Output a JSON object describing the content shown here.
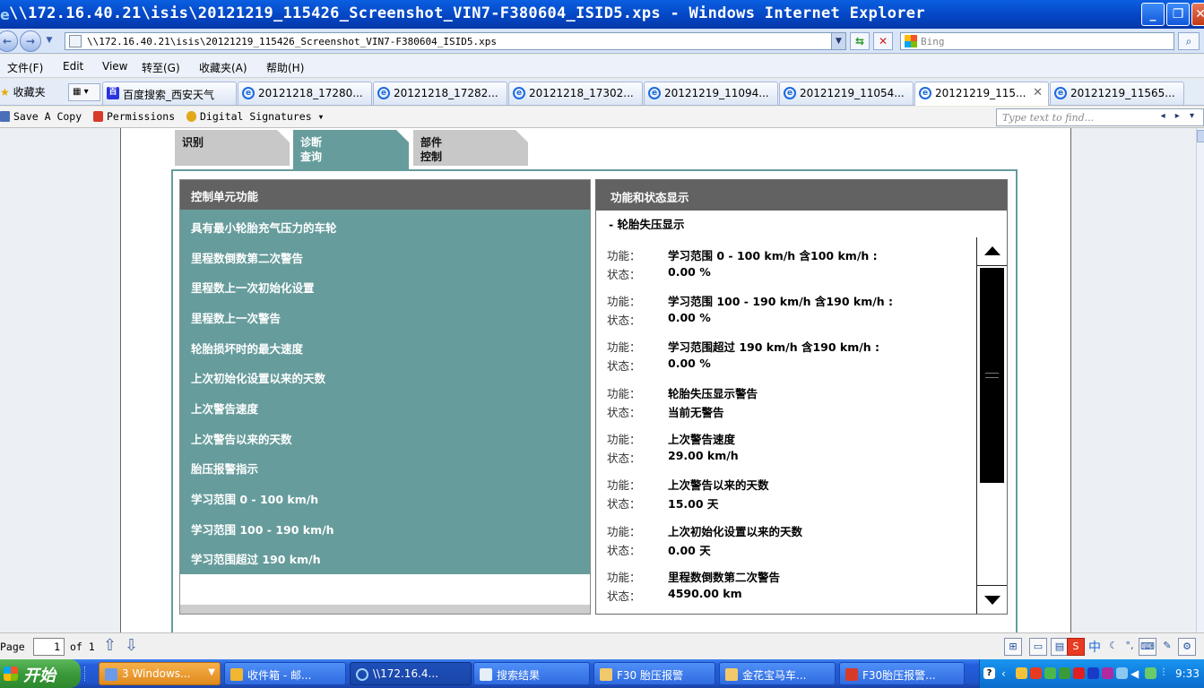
{
  "window": {
    "title": "\\\\172.16.40.21\\isis\\20121219_115426_Screenshot_VIN7-F380604_ISID5.xps - Windows Internet Explorer",
    "url": "\\\\172.16.40.21\\isis\\20121219_115426_Screenshot_VIN7-F380604_ISID5.xps",
    "search_placeholder": "Bing"
  },
  "menu": [
    "文件(F)",
    "Edit",
    "View",
    "转至(G)",
    "收藏夹(A)",
    "帮助(H)"
  ],
  "favorites_label": "收藏夹",
  "tabs": [
    {
      "label": "百度搜索_西安天气",
      "icon": "baidu-icon"
    },
    {
      "label": "20121218_17280...",
      "icon": "ie-icon"
    },
    {
      "label": "20121218_17282...",
      "icon": "ie-icon"
    },
    {
      "label": "20121218_17302...",
      "icon": "ie-icon"
    },
    {
      "label": "20121219_11094...",
      "icon": "ie-icon"
    },
    {
      "label": "20121219_11054...",
      "icon": "ie-icon"
    },
    {
      "label": "20121219_115...",
      "icon": "ie-icon",
      "active": true
    },
    {
      "label": "20121219_11565...",
      "icon": "ie-icon"
    }
  ],
  "xps_toolbar": {
    "save": "Save A Copy",
    "permissions": "Permissions",
    "signatures": "Digital Signatures",
    "find_placeholder": "Type text to find..."
  },
  "diag_tabs": [
    {
      "line1": "识别",
      "line2": ""
    },
    {
      "line1": "诊断",
      "line2": "查询"
    },
    {
      "line1": "部件",
      "line2": "控制"
    }
  ],
  "left_panel": {
    "header": "控制单元功能",
    "items": [
      "具有最小轮胎充气压力的车轮",
      "里程数倒数第二次警告",
      "里程数上一次初始化设置",
      "里程数上一次警告",
      "轮胎损坏时的最大速度",
      "上次初始化设置以来的天数",
      "上次警告速度",
      "上次警告以来的天数",
      "胎压报警指示",
      "学习范围 0 - 100 km/h",
      "学习范围 100 - 190 km/h",
      "学习范围超过 190 km/h"
    ]
  },
  "right_panel": {
    "header": "功能和状态显示",
    "subtitle": "- 轮胎失压显示",
    "func_label": "功能：",
    "status_label": "状态：",
    "entries": [
      {
        "func": "学习范围 0 - 100 km/h 含100 km/h :",
        "status": "0.00 %"
      },
      {
        "func": "学习范围 100 - 190 km/h 含190 km/h :",
        "status": "0.00 %"
      },
      {
        "func": "学习范围超过 190 km/h 含190 km/h :",
        "status": "0.00 %"
      },
      {
        "func": "轮胎失压显示警告",
        "status": "当前无警告"
      },
      {
        "func": "上次警告速度",
        "status": "29.00 km/h"
      },
      {
        "func": "上次警告以来的天数",
        "status": "15.00 天"
      },
      {
        "func": "上次初始化设置以来的天数",
        "status": "0.00 天"
      },
      {
        "func": "里程数倒数第二次警告",
        "status": "4590.00 km"
      }
    ]
  },
  "pagebar": {
    "page_label": "Page",
    "page_value": "1",
    "of_label": "of 1"
  },
  "taskbar": {
    "start": "开始",
    "items": [
      {
        "label": "3 Windows...",
        "style": "orange"
      },
      {
        "label": "收件箱 - 邮...",
        "style": "normal"
      },
      {
        "label": "\\\\172.16.4...",
        "style": "active"
      },
      {
        "label": "搜索结果",
        "style": "normal"
      },
      {
        "label": "F30 胎压报警",
        "style": "normal"
      },
      {
        "label": "金花宝马车...",
        "style": "normal"
      },
      {
        "label": "F30胎压报警...",
        "style": "normal"
      }
    ],
    "ime": "中",
    "clock": "9:33"
  }
}
